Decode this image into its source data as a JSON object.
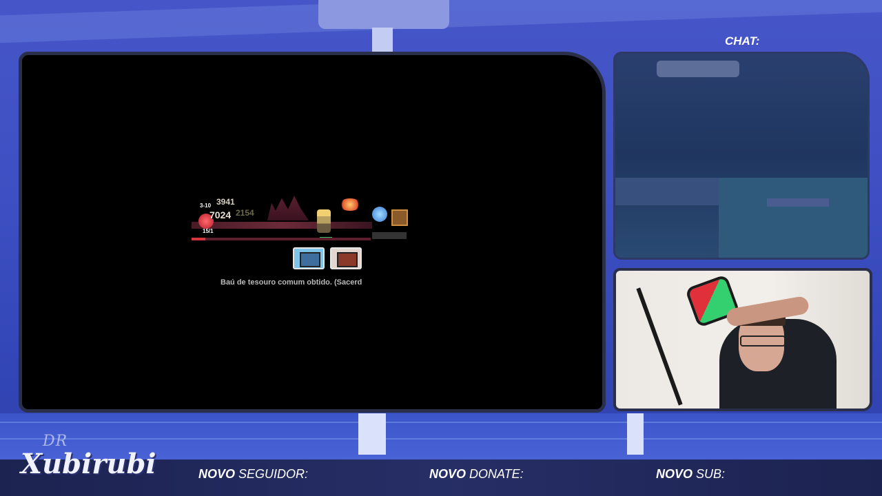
{
  "overlay": {
    "chat_title": "CHAT:",
    "logo_prefix": "DR",
    "logo_name": "Xubirubi",
    "events": [
      {
        "bold": "NOVO",
        "rest": " SEGUIDOR:"
      },
      {
        "bold": "NOVO",
        "rest": " DONATE:"
      },
      {
        "bold": "NOVO",
        "rest": " SUB:"
      }
    ]
  },
  "game": {
    "damage_numbers": [
      "3941",
      "7024",
      "2154",
      "3-10",
      "15/1"
    ],
    "message": "Baú de tesouro comum obtido. (Sacerd",
    "chest_buttons": [
      "common-chest",
      "rare-chest"
    ]
  },
  "colors": {
    "background": "#3a4fc0",
    "frame": "#2a2f4a",
    "bar": "#1c2350"
  }
}
